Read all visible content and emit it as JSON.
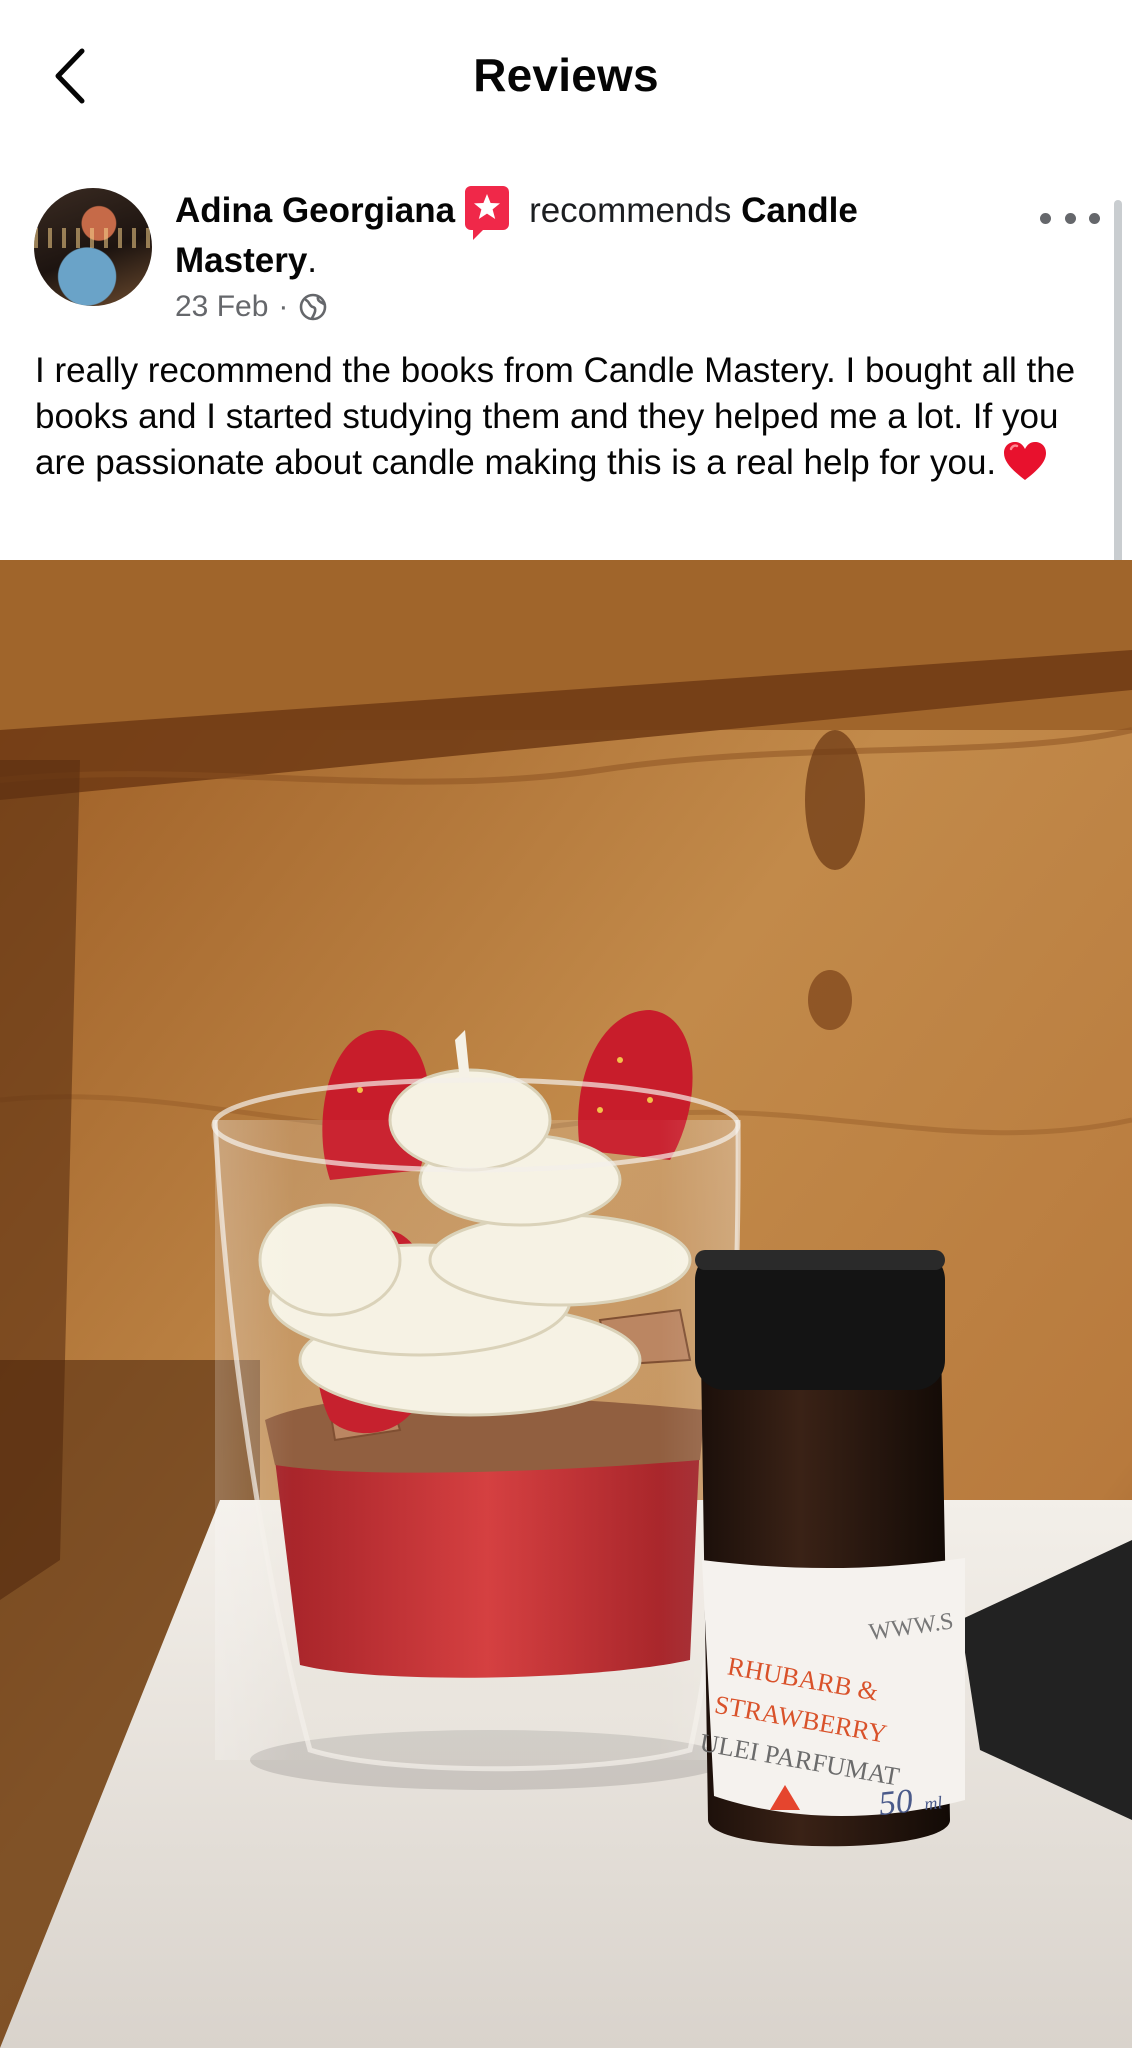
{
  "header": {
    "title": "Reviews",
    "back_icon": "chevron-left-icon"
  },
  "post": {
    "author": "Adina Georgiana",
    "recommend_badge_icon": "recommend-star-badge-icon",
    "verb": "recommends",
    "page_name": "Candle Mastery",
    "date": "23 Feb",
    "separator": "·",
    "audience_icon": "globe-icon",
    "more_icon": "more-dots-icon",
    "text": "I really recommend the books from Candle Mastery. I bought all the books and I started studying them and they helped me a lot. If you are passionate about candle making this is a real help for you.",
    "emoji": "heart-emoji-icon",
    "photo": {
      "label_line1": "RHUBARB &",
      "label_line2": "STRAWBERRY",
      "label_line3": "ULEI PARFUMAT",
      "label_web": "WWW.S",
      "label_volume": "50",
      "label_unit": "ml"
    }
  },
  "colors": {
    "accent_badge": "#f02849",
    "text_primary": "#050505",
    "text_secondary": "#65676b"
  }
}
